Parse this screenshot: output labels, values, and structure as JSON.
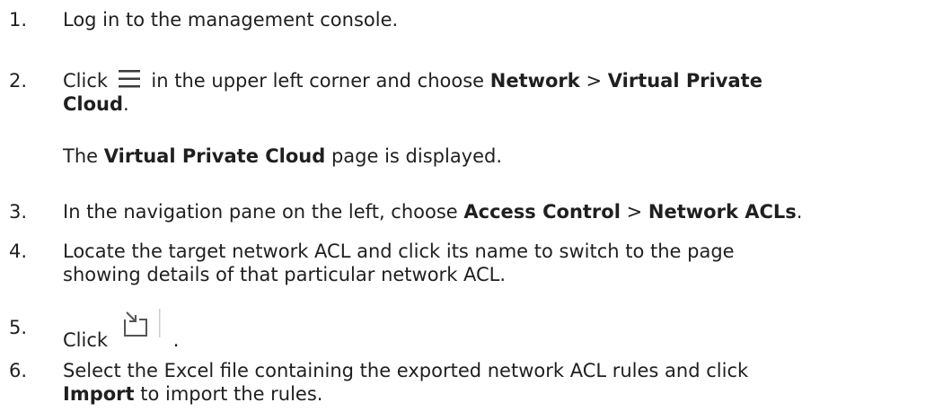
{
  "steps": [
    {
      "num": "1.",
      "text": "Log in to the management console."
    },
    {
      "num": "2.",
      "click": "Click",
      "icon": "menu-icon",
      "mid": "in the upper left corner and choose",
      "b1": "Network",
      "sep": ">",
      "b2a": "Virtual Private",
      "b2b": "Cloud",
      "end": ".",
      "note_pre": "The",
      "note_bold": "Virtual Private Cloud",
      "note_post": "page is displayed."
    },
    {
      "num": "3.",
      "pre": "In the navigation pane on the left, choose",
      "b1": "Access Control",
      "sep": ">",
      "b2": "Network ACLs",
      "end": "."
    },
    {
      "num": "4.",
      "line1": "Locate the target network ACL and click its name to switch to the page",
      "line2": "showing details of that particular network ACL."
    },
    {
      "num": "5.",
      "click": "Click",
      "icon": "import-icon",
      "end": "."
    },
    {
      "num": "6.",
      "line1": "Select the Excel file containing the exported network ACL rules and click",
      "bold": "Import",
      "rest": "to import the rules."
    }
  ]
}
